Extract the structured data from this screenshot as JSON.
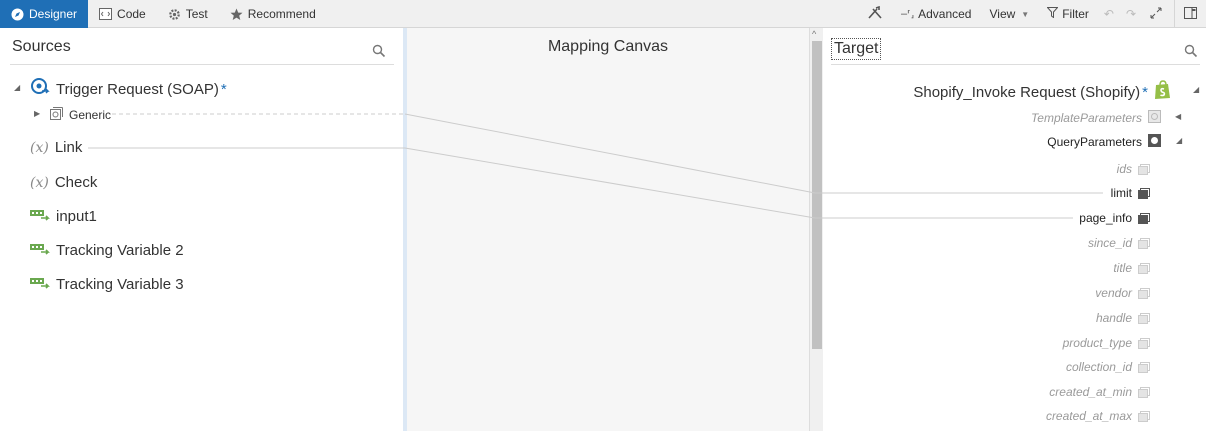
{
  "toolbar": {
    "tabs": [
      {
        "label": "Designer",
        "icon": "compass-icon",
        "active": true
      },
      {
        "label": "Code",
        "icon": "code-icon"
      },
      {
        "label": "Test",
        "icon": "gear-icon"
      },
      {
        "label": "Recommend",
        "icon": "star-icon"
      }
    ],
    "advanced_label": "Advanced",
    "view_label": "View",
    "filter_label": "Filter"
  },
  "sources": {
    "title": "Sources",
    "trigger": "Trigger Request (SOAP)",
    "required_mark": "*",
    "generic": "Generic",
    "var_symbol": "(x)",
    "items": [
      "Link",
      "Check",
      "input1",
      "Tracking Variable 2",
      "Tracking Variable 3"
    ]
  },
  "canvas": {
    "title": "Mapping Canvas"
  },
  "target": {
    "title": "Target",
    "root": "Shopify_Invoke Request (Shopify)",
    "required_mark": "*",
    "template_params": "TemplateParameters",
    "query_params": "QueryParameters",
    "fields": [
      "ids",
      "limit",
      "page_info",
      "since_id",
      "title",
      "vendor",
      "handle",
      "product_type",
      "collection_id",
      "created_at_min",
      "created_at_max"
    ],
    "mapped_fields": [
      "limit",
      "page_info"
    ]
  },
  "colors": {
    "accent": "#1f6fb6",
    "shopify_green": "#95bf47",
    "var_icon_green": "#6aa84f"
  }
}
